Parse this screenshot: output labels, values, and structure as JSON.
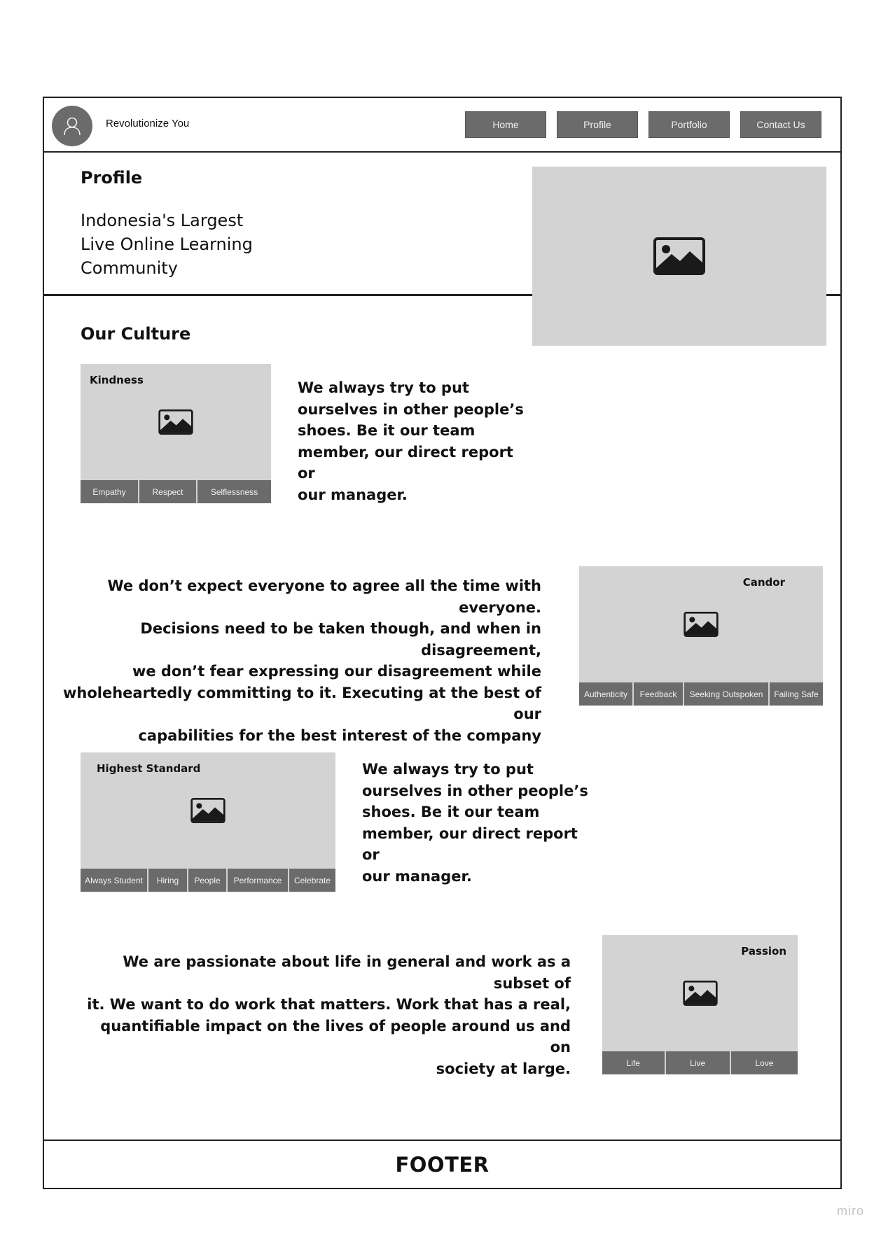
{
  "header": {
    "brand": "Revolutionize You",
    "nav": [
      "Home",
      "Profile",
      "Portfolio",
      "Contact Us"
    ]
  },
  "hero": {
    "title": "Profile",
    "subtitle_lines": [
      "Indonesia's Largest",
      "Live Online Learning",
      "Community"
    ]
  },
  "culture": {
    "title": "Our Culture",
    "cards": [
      {
        "title": "Kindness",
        "tags": [
          "Empathy",
          "Respect",
          "Selflessness"
        ],
        "description_lines": [
          "We always try to put",
          "ourselves in other people’s",
          "shoes. Be it our team",
          "member, our direct report or",
          "our manager."
        ]
      },
      {
        "title": "Candor",
        "tags": [
          "Authenticity",
          "Feedback",
          "Seeking Outspoken",
          "Failing Safe"
        ],
        "description_lines": [
          "We don’t expect everyone to agree all the time with everyone.",
          "Decisions need to be taken though, and when in disagreement,",
          "we don’t fear expressing our disagreement while",
          "wholeheartedly committing to it. Executing at the best of our",
          "capabilities for the best interest of the company"
        ]
      },
      {
        "title": "Highest Standard",
        "tags": [
          "Always Student",
          "Hiring",
          "People",
          "Performance",
          "Celebrate"
        ],
        "description_lines": [
          "We always try to put",
          "ourselves in other people’s",
          "shoes. Be it our team",
          "member, our direct report or",
          "our manager."
        ]
      },
      {
        "title": "Passion",
        "tags": [
          "Life",
          "Live",
          "Love"
        ],
        "description_lines": [
          "We are passionate about life in general and work as a subset of",
          "it. We want to do work that matters. Work that has a real,",
          "quantifiable impact on the lives of people around us and on",
          "society at large."
        ]
      }
    ]
  },
  "footer": {
    "label": "FOOTER"
  },
  "watermark": "miro",
  "colors": {
    "button": "#6b6b6b",
    "placeholder": "#d3d3d3",
    "border": "#222222"
  },
  "icons": {
    "avatar": "user-icon",
    "placeholder": "image-icon"
  }
}
